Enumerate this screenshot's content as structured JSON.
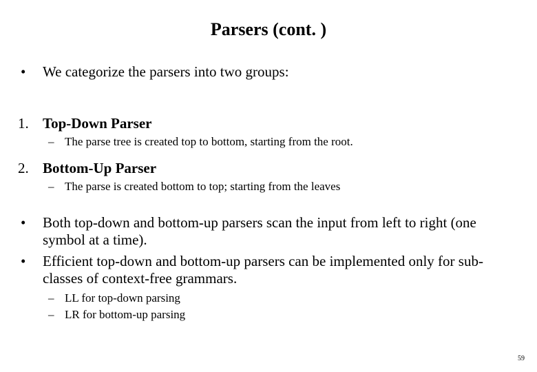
{
  "title": "Parsers (cont. )",
  "bullet_marker": "•",
  "dash_marker": "–",
  "intro": "We categorize the parsers into two groups:",
  "items": {
    "one_marker": "1.",
    "one_title": "Top-Down Parser",
    "one_sub": "The parse tree is created top to bottom, starting from the root.",
    "two_marker": "2.",
    "two_title": "Bottom-Up Parser",
    "two_sub": "The parse is created bottom to top; starting from the leaves"
  },
  "points": {
    "p1": "Both top-down and bottom-up parsers scan the input from left to right (one symbol at a time).",
    "p2": "Efficient top-down and bottom-up parsers can be implemented only for sub-classes of context-free grammars.",
    "sub1": "LL for top-down parsing",
    "sub2": "LR for bottom-up parsing"
  },
  "page_number": "59"
}
